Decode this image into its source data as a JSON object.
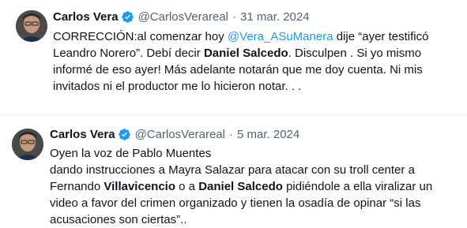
{
  "tweets": [
    {
      "author": "Carlos Vera",
      "handle": "@CarlosVerareal",
      "separator": "·",
      "date": "31 mar. 2024",
      "text": {
        "p1": "CORRECCIÓN:al comenzar hoy ",
        "mention": "@Vera_ASuManera",
        "p2": " dije “ayer testificó Leandro Norero”. Debí decir ",
        "bold": "Daniel Salcedo",
        "p3": ". Disculpen . Si yo mismo informé de eso ayer! Más adelante notarán que me doy cuenta. Ni mis invitados ni el productor me lo hicieron notar. . ."
      }
    },
    {
      "author": "Carlos Vera",
      "handle": "@CarlosVerareal",
      "separator": "·",
      "date": "5 mar. 2024",
      "text": {
        "line1": "Oyen la voz de Pablo Muentes",
        "p1": "dando instrucciones a Mayra Salazar para atacar con su troll center a Fernando ",
        "bold1": "Villavicencio",
        "p2": " o a ",
        "bold2": "Daniel Salcedo",
        "p3": " pidiéndole a ella viralizar un video a favor del crimen organizado y tienen la osadía de opinar “si las acusaciones son ciertas”.."
      }
    }
  ],
  "colors": {
    "link": "#1d9bf0",
    "verified": "#1d9bf0",
    "muted": "#536471",
    "text": "#0f1419"
  },
  "icons": {
    "verified": "verified-badge-icon",
    "avatar": "profile-photo"
  }
}
